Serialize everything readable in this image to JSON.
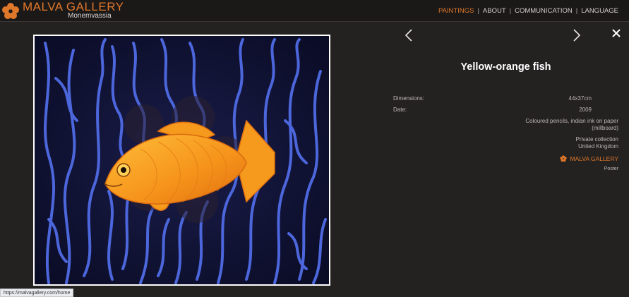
{
  "header": {
    "brand": "MALVA GALLERY",
    "subtitle": "Monemvassia",
    "nav": [
      {
        "label": "PAINTINGS",
        "active": true
      },
      {
        "label": "ABOUT",
        "active": false
      },
      {
        "label": "COMMUNICATION",
        "active": false
      },
      {
        "label": "LANGUAGE",
        "active": false
      }
    ],
    "separator": "|"
  },
  "detail": {
    "title": "Yellow-orange fish",
    "dimensions_label": "Dimensions:",
    "dimensions_value": "44x37cm",
    "date_label": "Date:",
    "date_value": "2009",
    "medium_line1": "Coloured pencils, indian ink on paper",
    "medium_line2": "(millboard)",
    "collection_line1": "Private collection",
    "collection_line2": "United Kingdom",
    "gallery_link": "MALVA GALLERY",
    "poster_label": "Poster"
  },
  "controls": {
    "prev": "previous-artwork",
    "next": "next-artwork",
    "close": "close"
  },
  "status_bar": {
    "url": "https://malvagallery.com/home"
  },
  "colors": {
    "accent": "#e0782a",
    "background": "#242121",
    "header_bg": "#1b1818",
    "artwork_bg": "#0f1132",
    "seaweed": "#4a63d6",
    "fish": "#f59a1c"
  },
  "icons": [
    "malva-flower-icon",
    "chevron-left-icon",
    "chevron-right-icon",
    "close-icon"
  ]
}
